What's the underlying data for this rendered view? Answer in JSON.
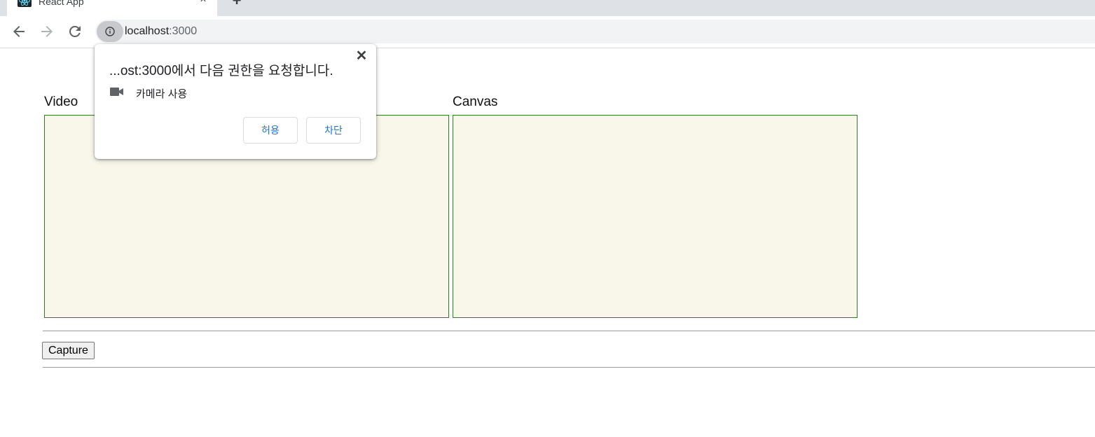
{
  "browser": {
    "tab": {
      "title": "React App",
      "favicon": "react-logo-icon",
      "close_label": "×"
    },
    "new_tab_label": "+",
    "nav": {
      "back": "back-arrow-icon",
      "forward": "forward-arrow-icon",
      "reload": "reload-icon"
    },
    "address": {
      "host": "localhost",
      "port": ":3000"
    }
  },
  "page": {
    "video_label": "Video",
    "canvas_label": "Canvas",
    "capture_label": "Capture"
  },
  "permission_popup": {
    "close_label": "✕",
    "title": "...ost:3000에서 다음 권한을 요청합니다.",
    "permission_label": "카메라 사용",
    "permission_icon": "video-camera-icon",
    "allow_label": "허용",
    "block_label": "차단"
  },
  "colors": {
    "panel_fill": "#f8f7ea",
    "panel_border": "#2e7d1f",
    "link_blue": "#1a73e8"
  }
}
